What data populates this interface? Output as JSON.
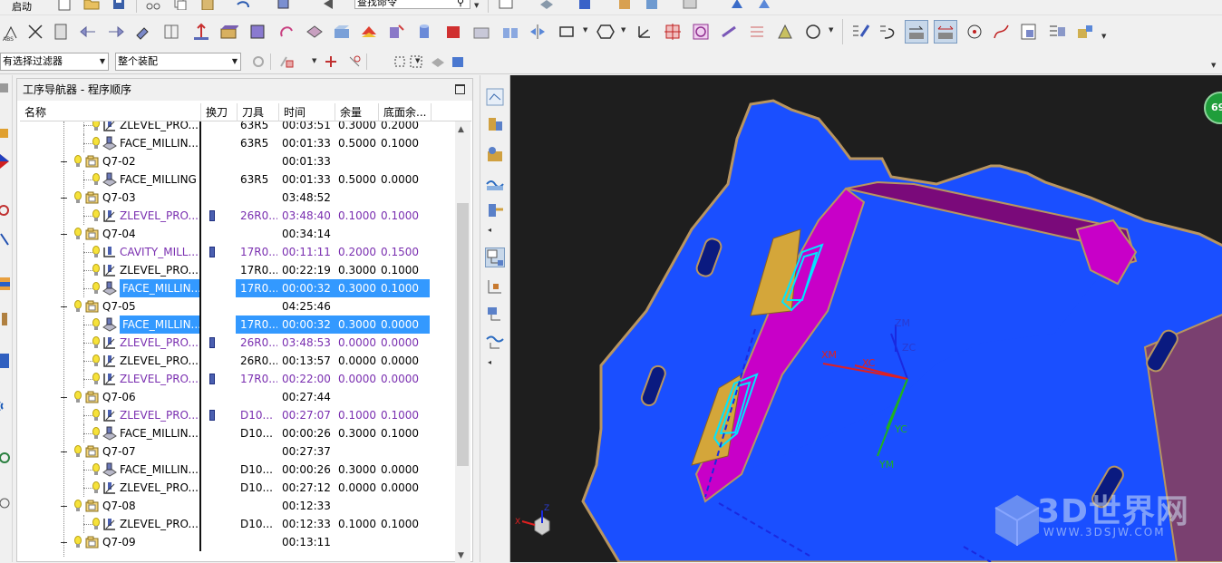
{
  "toolbar": {
    "start_menu_label": "启动",
    "command_finder_value": "查找命令",
    "selection_filter_value": "有选择过滤器",
    "assembly_scope_value": "整个装配"
  },
  "navigator": {
    "title": "工序导航器 - 程序顺序",
    "columns": [
      "名称",
      "换刀",
      "刀具",
      "时间",
      "余量",
      "底面余..."
    ],
    "rows": [
      {
        "type": "op",
        "name": "ZLEVEL_PRO...",
        "icon": "zlevel-profile-icon",
        "cutter": "63R5",
        "time": "00:03:51",
        "stock": "0.3000",
        "floor": "0.2000"
      },
      {
        "type": "op",
        "name": "FACE_MILLIN...",
        "icon": "face-milling-icon",
        "cutter": "63R5",
        "time": "00:01:33",
        "stock": "0.5000",
        "floor": "0.1000"
      },
      {
        "type": "group",
        "name": "Q7-02",
        "time": "00:01:33"
      },
      {
        "type": "op",
        "name": "FACE_MILLING",
        "icon": "face-milling-icon",
        "cutter": "63R5",
        "time": "00:01:33",
        "stock": "0.5000",
        "floor": "0.0000"
      },
      {
        "type": "group",
        "name": "Q7-03",
        "time": "03:48:52"
      },
      {
        "type": "op",
        "name": "ZLEVEL_PRO...",
        "icon": "zlevel-profile-icon",
        "purple": true,
        "toolchange": true,
        "cutter": "26R0...",
        "time": "03:48:40",
        "stock": "0.1000",
        "floor": "0.1000"
      },
      {
        "type": "group",
        "name": "Q7-04",
        "time": "00:34:14"
      },
      {
        "type": "op",
        "name": "CAVITY_MILL...",
        "icon": "cavity-mill-icon",
        "purple": true,
        "toolchange": true,
        "cutter": "17R0...",
        "time": "00:11:11",
        "stock": "0.2000",
        "floor": "0.1500"
      },
      {
        "type": "op",
        "name": "ZLEVEL_PRO...",
        "icon": "zlevel-profile-icon",
        "cutter": "17R0...",
        "time": "00:22:19",
        "stock": "0.3000",
        "floor": "0.1000"
      },
      {
        "type": "op",
        "name": "FACE_MILLIN...",
        "icon": "face-milling-icon",
        "selected": true,
        "cutter": "17R0...",
        "time": "00:00:32",
        "stock": "0.3000",
        "floor": "0.1000"
      },
      {
        "type": "group",
        "name": "Q7-05",
        "time": "04:25:46"
      },
      {
        "type": "op",
        "name": "FACE_MILLIN...",
        "icon": "face-milling-icon",
        "selected": true,
        "cutter": "17R0...",
        "time": "00:00:32",
        "stock": "0.3000",
        "floor": "0.0000"
      },
      {
        "type": "op",
        "name": "ZLEVEL_PRO...",
        "icon": "zlevel-profile-icon",
        "purple": true,
        "toolchange": true,
        "cutter": "26R0...",
        "time": "03:48:53",
        "stock": "0.0000",
        "floor": "0.0000"
      },
      {
        "type": "op",
        "name": "ZLEVEL_PRO...",
        "icon": "zlevel-profile-icon",
        "cutter": "26R0...",
        "time": "00:13:57",
        "stock": "0.0000",
        "floor": "0.0000"
      },
      {
        "type": "op",
        "name": "ZLEVEL_PRO...",
        "icon": "zlevel-profile-icon",
        "purple": true,
        "toolchange": true,
        "cutter": "17R0...",
        "time": "00:22:00",
        "stock": "0.0000",
        "floor": "0.0000"
      },
      {
        "type": "group",
        "name": "Q7-06",
        "time": "00:27:44"
      },
      {
        "type": "op",
        "name": "ZLEVEL_PRO...",
        "icon": "zlevel-profile-icon",
        "purple": true,
        "toolchange": true,
        "cutter": "D10...",
        "time": "00:27:07",
        "stock": "0.1000",
        "floor": "0.1000"
      },
      {
        "type": "op",
        "name": "FACE_MILLIN...",
        "icon": "face-milling-icon",
        "cutter": "D10...",
        "time": "00:00:26",
        "stock": "0.3000",
        "floor": "0.1000"
      },
      {
        "type": "group",
        "name": "Q7-07",
        "time": "00:27:37"
      },
      {
        "type": "op",
        "name": "FACE_MILLIN...",
        "icon": "face-milling-icon",
        "cutter": "D10...",
        "time": "00:00:26",
        "stock": "0.3000",
        "floor": "0.0000"
      },
      {
        "type": "op",
        "name": "ZLEVEL_PRO...",
        "icon": "zlevel-profile-icon",
        "cutter": "D10...",
        "time": "00:27:12",
        "stock": "0.0000",
        "floor": "0.0000"
      },
      {
        "type": "group",
        "name": "Q7-08",
        "time": "00:12:33"
      },
      {
        "type": "op",
        "name": "ZLEVEL_PRO...",
        "icon": "zlevel-profile-icon",
        "cutter": "D10...",
        "time": "00:12:33",
        "stock": "0.1000",
        "floor": "0.1000"
      },
      {
        "type": "group",
        "name": "Q7-09",
        "time": "00:13:11"
      }
    ]
  },
  "viewport": {
    "axis_labels": {
      "zm": "ZM",
      "zc": "ZC",
      "xm": "XM",
      "xc": "XC",
      "yc": "YC",
      "ym": "YM",
      "triad_z": "Z",
      "triad_x": "X"
    },
    "badge_text": "69",
    "watermark": {
      "main": "3D世界网",
      "sub": "WWW.3DSJW.COM"
    },
    "colors": {
      "background": "#1e1e1e",
      "part_face": "#1a4fff",
      "wall": "#c800c8",
      "wall_dark": "#7a0a7a",
      "floor_gold": "#d4a63a",
      "edge": "#b89560",
      "toolpath": "#00e5ff"
    }
  },
  "colors": {
    "selection": "#3399ff",
    "tool_change_text": "#7a2fb0",
    "toolbar_bg": "#f0f0f0"
  }
}
